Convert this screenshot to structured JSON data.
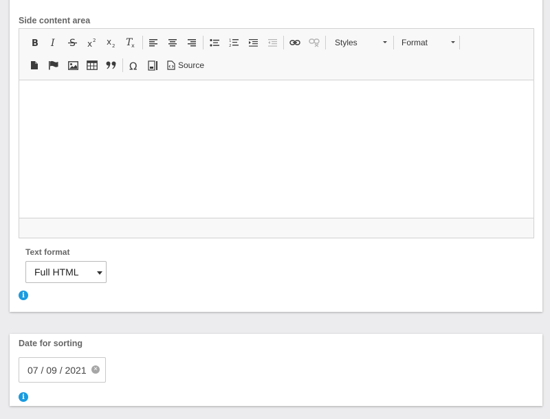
{
  "content_section": {
    "label": "Side content area",
    "toolbar": {
      "row1": [
        {
          "name": "bold-icon"
        },
        {
          "name": "italic-icon"
        },
        {
          "name": "strikethrough-icon"
        },
        {
          "name": "superscript-icon"
        },
        {
          "name": "subscript-icon"
        },
        {
          "name": "remove-format-icon"
        },
        {
          "name": "align-left-icon"
        },
        {
          "name": "align-center-icon"
        },
        {
          "name": "align-right-icon"
        },
        {
          "name": "bulleted-list-icon"
        },
        {
          "name": "numbered-list-icon"
        },
        {
          "name": "increase-indent-icon"
        },
        {
          "name": "decrease-indent-icon",
          "disabled": true
        },
        {
          "name": "link-icon"
        },
        {
          "name": "unlink-icon",
          "disabled": true
        }
      ],
      "styles_label": "Styles",
      "format_label": "Format",
      "row2": [
        {
          "name": "template-icon"
        },
        {
          "name": "anchor-flag-icon"
        },
        {
          "name": "image-icon"
        },
        {
          "name": "table-icon"
        },
        {
          "name": "blockquote-icon"
        },
        {
          "name": "special-character-icon"
        },
        {
          "name": "show-blocks-icon"
        },
        {
          "name": "source-icon"
        }
      ],
      "source_label": "Source"
    },
    "text_format": {
      "label": "Text format",
      "selected": "Full HTML"
    },
    "info_glyph": "i"
  },
  "date_section": {
    "label": "Date for sorting",
    "value": "07 / 09 / 2021",
    "clear_glyph": "×",
    "info_glyph": "i"
  },
  "colors": {
    "info_blue": "#1a9be0",
    "toolbar_bg": "#f8f8f8",
    "page_bg": "#ececee"
  }
}
